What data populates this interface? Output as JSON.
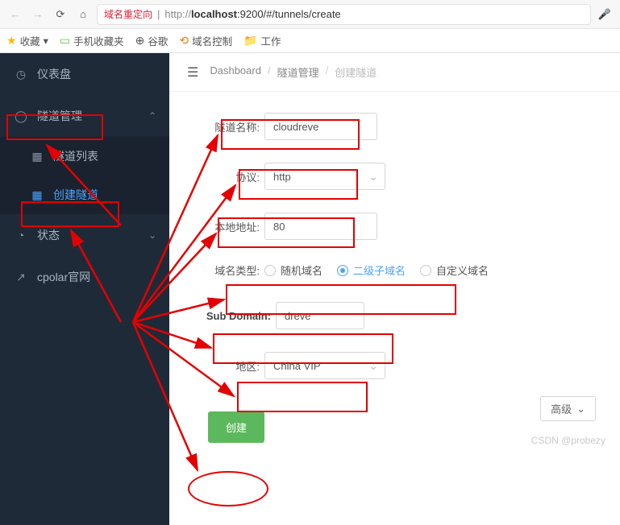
{
  "browser": {
    "redirect_label": "域名重定向",
    "url_prefix": "http://",
    "url_host": "localhost",
    "url_port_path": ":9200/#/tunnels/create"
  },
  "bookmarks": {
    "fav": "收藏",
    "mobile": "手机收藏夹",
    "google": "谷歌",
    "domain": "域名控制",
    "work": "工作"
  },
  "sidebar": {
    "dashboard": "仪表盘",
    "tunnel_mgmt": "隧道管理",
    "tunnel_list": "隧道列表",
    "tunnel_create": "创建隧道",
    "status": "状态",
    "official": "cpolar官网"
  },
  "breadcrumb": {
    "a": "Dashboard",
    "b": "隧道管理",
    "c": "创建隧道"
  },
  "form": {
    "name_label": "隧道名称:",
    "name_value": "cloudreve",
    "proto_label": "协议:",
    "proto_value": "http",
    "local_label": "本地地址:",
    "local_value": "80",
    "domaintype_label": "域名类型:",
    "domaintype_random": "随机域名",
    "domaintype_sub": "二级子域名",
    "domaintype_custom": "自定义域名",
    "subdomain_label": "Sub Domain:",
    "subdomain_value": "dreve",
    "region_label": "地区:",
    "region_value": "China VIP",
    "advanced": "高级",
    "create": "创建"
  },
  "watermark": "CSDN @probezy"
}
